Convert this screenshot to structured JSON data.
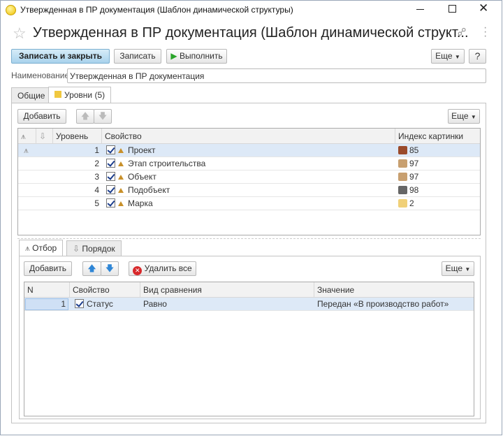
{
  "window": {
    "title": "Утвержденная в ПР документация (Шаблон динамической структуры)"
  },
  "header": {
    "title": "Утвержденная в ПР документация (Шаблон динамической структ..."
  },
  "toolbar": {
    "save_close": "Записать и закрыть",
    "save": "Записать",
    "run": "Выполнить",
    "more": "Еще",
    "help": "?"
  },
  "name_field": {
    "label": "Наименование:",
    "value": "Утвержденная в ПР документация"
  },
  "tabs": [
    {
      "label": "Общие"
    },
    {
      "label": "Уровни (5)"
    }
  ],
  "levels": {
    "add": "Добавить",
    "more": "Еще",
    "columns": [
      "Уровень",
      "Свойство",
      "Индекс картинки"
    ],
    "rows": [
      {
        "level": "1",
        "property": "Проект",
        "index": "85",
        "pic_color": "#9a4a2a"
      },
      {
        "level": "2",
        "property": "Этап строительства",
        "index": "97",
        "pic_color": "#c8a070"
      },
      {
        "level": "3",
        "property": "Объект",
        "index": "97",
        "pic_color": "#c8a070"
      },
      {
        "level": "4",
        "property": "Подобъект",
        "index": "98",
        "pic_color": "#666666"
      },
      {
        "level": "5",
        "property": "Марка",
        "index": "2",
        "pic_color": "#f0d078"
      }
    ]
  },
  "subtabs": [
    {
      "label": "Отбор"
    },
    {
      "label": "Порядок"
    }
  ],
  "filter": {
    "add": "Добавить",
    "delete_all": "Удалить все",
    "more": "Еще",
    "columns": [
      "N",
      "Свойство",
      "Вид сравнения",
      "Значение"
    ],
    "rows": [
      {
        "n": "1",
        "property": "Статус",
        "comparison": "Равно",
        "value": "Передан «В производство работ»"
      }
    ]
  }
}
